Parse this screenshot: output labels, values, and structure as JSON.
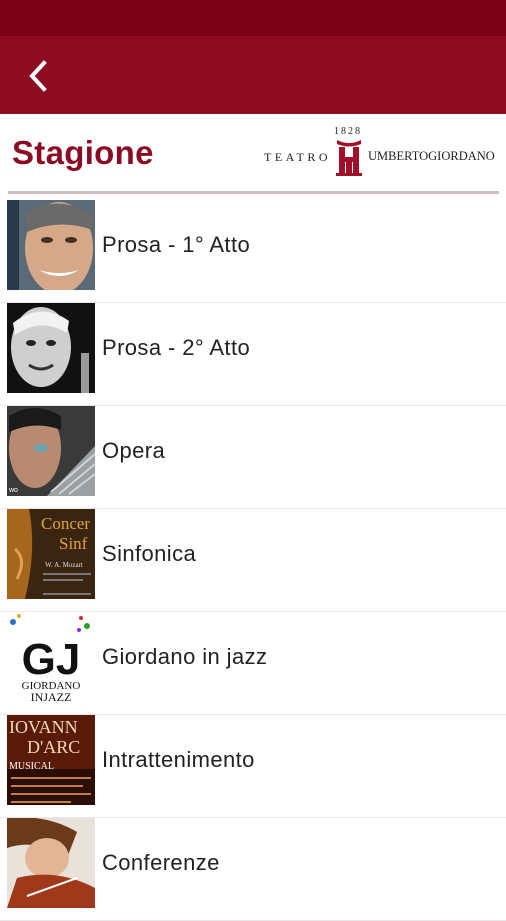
{
  "app": {
    "title": "Stagione",
    "logo": {
      "year": "1828",
      "teatro": "TEATRO",
      "name": "UMBERTOGIORDANO"
    },
    "colors": {
      "statusbar": "#7a0018",
      "appbar": "#8e0c22",
      "title": "#8b0b22"
    }
  },
  "toolbar": {
    "back_icon": "chevron-left-icon"
  },
  "seasons": [
    {
      "label": "Prosa - 1° Atto",
      "thumb": "portrait-smiling-man"
    },
    {
      "label": "Prosa - 2° Atto",
      "thumb": "portrait-elderly-man-bw"
    },
    {
      "label": "Opera",
      "thumb": "portrait-man-with-fan"
    },
    {
      "label": "Sinfonica",
      "thumb": "concert-poster-violin"
    },
    {
      "label": "Giordano in jazz",
      "thumb": "giordano-jazz-logo",
      "thumb_text": {
        "mark": "GJ",
        "line1": "GIORDANO",
        "line2": "INJAZZ"
      }
    },
    {
      "label": "Intrattenimento",
      "thumb": "musical-poster",
      "thumb_text": {
        "line1": "IOVANN",
        "line2": "D'ARC",
        "line3": "MUSICAL"
      }
    },
    {
      "label": "Conferenze",
      "thumb": "violinist-photo"
    }
  ]
}
